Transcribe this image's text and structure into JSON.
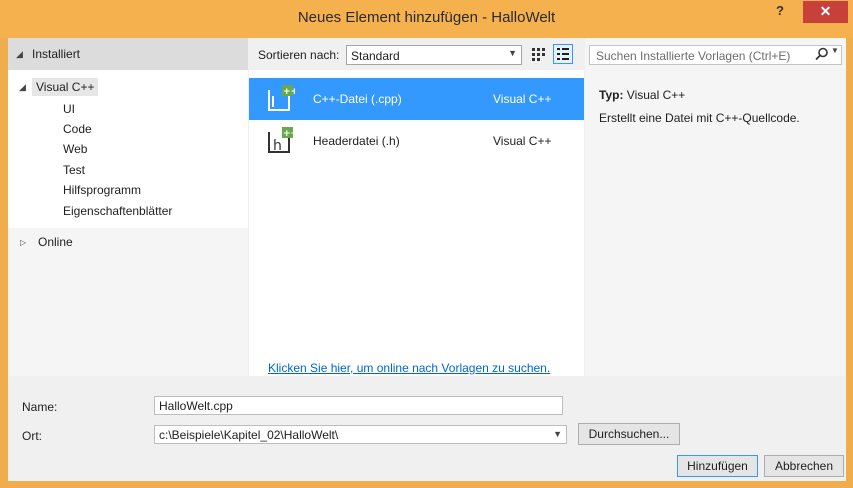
{
  "window": {
    "title": "Neues Element hinzufügen - HalloWelt",
    "help_label": "?",
    "close_label": "✕"
  },
  "left_panel": {
    "header": "Installiert",
    "tree": {
      "root": "Visual C++",
      "children": [
        "UI",
        "Code",
        "Web",
        "Test",
        "Hilfsprogramm",
        "Eigenschaftenblätter"
      ]
    },
    "online": "Online"
  },
  "middle_panel": {
    "sort_label": "Sortieren nach:",
    "sort_value": "Standard",
    "view_icons": [
      "grid-view-icon",
      "list-view-icon"
    ],
    "templates": [
      {
        "name": "C++-Datei (.cpp)",
        "language": "Visual C++",
        "icon": "cpp-file-icon",
        "selected": true
      },
      {
        "name": "Headerdatei (.h)",
        "language": "Visual C++",
        "icon": "header-file-icon",
        "selected": false
      }
    ],
    "online_link": "Klicken Sie hier, um online nach Vorlagen zu suchen."
  },
  "right_panel": {
    "search_placeholder": "Suchen Installierte Vorlagen (Ctrl+E)",
    "type_label": "Typ:",
    "type_value": "Visual C++",
    "description": "Erstellt eine Datei mit C++-Quellcode."
  },
  "bottom": {
    "name_label": "Name:",
    "name_value": "HalloWelt.cpp",
    "ort_label": "Ort:",
    "ort_value": "c:\\Beispiele\\Kapitel_02\\HalloWelt\\",
    "browse_label": "Durchsuchen...",
    "add_label": "Hinzufügen",
    "cancel_label": "Abbrechen"
  },
  "colors": {
    "title_bar": "#f6b14f",
    "close_button": "#c7413a",
    "selection": "#3399ff",
    "link": "#0066cc"
  }
}
